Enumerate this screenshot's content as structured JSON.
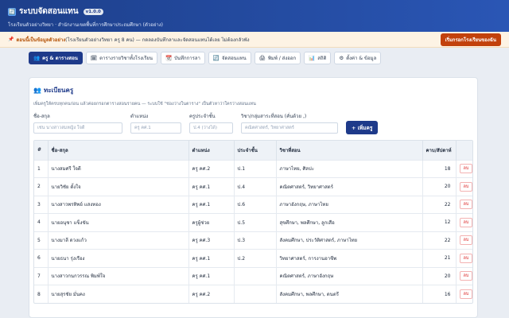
{
  "header": {
    "logo_icon": "🔄",
    "title": "ระบบจัดสอนแทน",
    "version": "v1.0.0",
    "subtitle": "โรงเรียนตัวอย่างวิทยา · สำนักงานเขตพื้นที่การศึกษาประถมศึกษา (ตัวอย่าง)"
  },
  "notice": {
    "pin_icon": "📌",
    "bold_text": "ตอนนี้เป็นข้อมูลตัวอย่าง",
    "text": " (โรงเรียนตัวอย่างวิทยา ครู 8 คน) — กดลองบันทึกลาและจัดสอนแทนได้เลย ไม่ต้องกลัวพัง",
    "reset_button": "เริ่มกรอกโรงเรียนของฉัน"
  },
  "tabs": [
    {
      "icon": "👥",
      "label": "ครู & ตารางสอน"
    },
    {
      "icon": "🗓",
      "label": "ตารางรายวิชาทั้งโรงเรียน"
    },
    {
      "icon": "📆",
      "label": "บันทึกการลา"
    },
    {
      "icon": "🔄",
      "label": "จัดสอนแทน"
    },
    {
      "icon": "🖨",
      "label": "พิมพ์ / ส่งออก"
    },
    {
      "icon": "📊",
      "label": "สถิติ"
    },
    {
      "icon": "⚙",
      "label": "ตั้งค่า & ข้อมูล"
    }
  ],
  "panel": {
    "icon": "👥",
    "title": "ทะเบียนครู",
    "description": "เพิ่มครูให้ครบทุกคนก่อน แล้วค่อยกรอกตารางสอนรายคน — ระบบใช้ \"ช่องว่างในตาราง\" เป็นตัวหาว่าใครว่างสอนแทน"
  },
  "form": {
    "name_label": "ชื่อ-สกุล",
    "name_placeholder": "เช่น นางสาวสมหญิง ใจดี",
    "position_label": "ตำแหน่ง",
    "position_placeholder": "ครู คศ.1",
    "class_label": "ครูประจำชั้น",
    "class_placeholder": "ป.4 (ว่างได้)",
    "subject_label": "วิชา/กลุ่มสาระที่สอน (คั่นด้วย ,)",
    "subject_placeholder": "คณิตศาสตร์, วิทยาศาสตร์",
    "add_button": "+ เพิ่มครู"
  },
  "table": {
    "headers": [
      "#",
      "ชื่อ-สกุล",
      "ตำแหน่ง",
      "ประจำชั้น",
      "วิชาที่สอน",
      "คาบ/สัปดาห์",
      ""
    ],
    "delete_label": "ลบ",
    "rows": [
      {
        "no": "1",
        "name": "นางสมศรี ใจดี",
        "position": "ครู คศ.2",
        "class": "ป.1",
        "subjects": "ภาษาไทย, ศิลปะ",
        "periods": "18"
      },
      {
        "no": "2",
        "name": "นายวิชัย ตั้งใจ",
        "position": "ครู คศ.1",
        "class": "ป.4",
        "subjects": "คณิตศาสตร์, วิทยาศาสตร์",
        "periods": "20"
      },
      {
        "no": "3",
        "name": "นางสาวพรทิพย์ แสงทอง",
        "position": "ครู คศ.1",
        "class": "ป.6",
        "subjects": "ภาษาอังกฤษ, ภาษาไทย",
        "periods": "22"
      },
      {
        "no": "4",
        "name": "นายอนุชา แข็งขัน",
        "position": "ครูผู้ช่วย",
        "class": "ป.5",
        "subjects": "สุขศึกษา, พลศึกษา, ลูกเสือ",
        "periods": "12"
      },
      {
        "no": "5",
        "name": "นางมาลี ดวงแก้ว",
        "position": "ครู คศ.3",
        "class": "ป.3",
        "subjects": "สังคมศึกษา, ประวัติศาสตร์, ภาษาไทย",
        "periods": "22"
      },
      {
        "no": "6",
        "name": "นายธนา รุ่งเรือง",
        "position": "ครู คศ.1",
        "class": "ป.2",
        "subjects": "วิทยาศาสตร์, การงานอาชีพ",
        "periods": "21"
      },
      {
        "no": "7",
        "name": "นางสาวกนกวรรณ พิมพ์ใจ",
        "position": "ครู คศ.1",
        "class": "",
        "subjects": "คณิตศาสตร์, ภาษาอังกฤษ",
        "periods": "20"
      },
      {
        "no": "8",
        "name": "นายสุรชัย มั่นคง",
        "position": "ครู คศ.2",
        "class": "",
        "subjects": "สังคมศึกษา, พลศึกษา, ดนตรี",
        "periods": "16"
      }
    ]
  },
  "colors": {
    "header_start": "#1d3f8a",
    "header_end": "#2a56b5",
    "accent": "#1e3a8a",
    "danger": "#dc2626",
    "reset_button": "#c2410c",
    "notice_bg": "#fdf3e4"
  }
}
